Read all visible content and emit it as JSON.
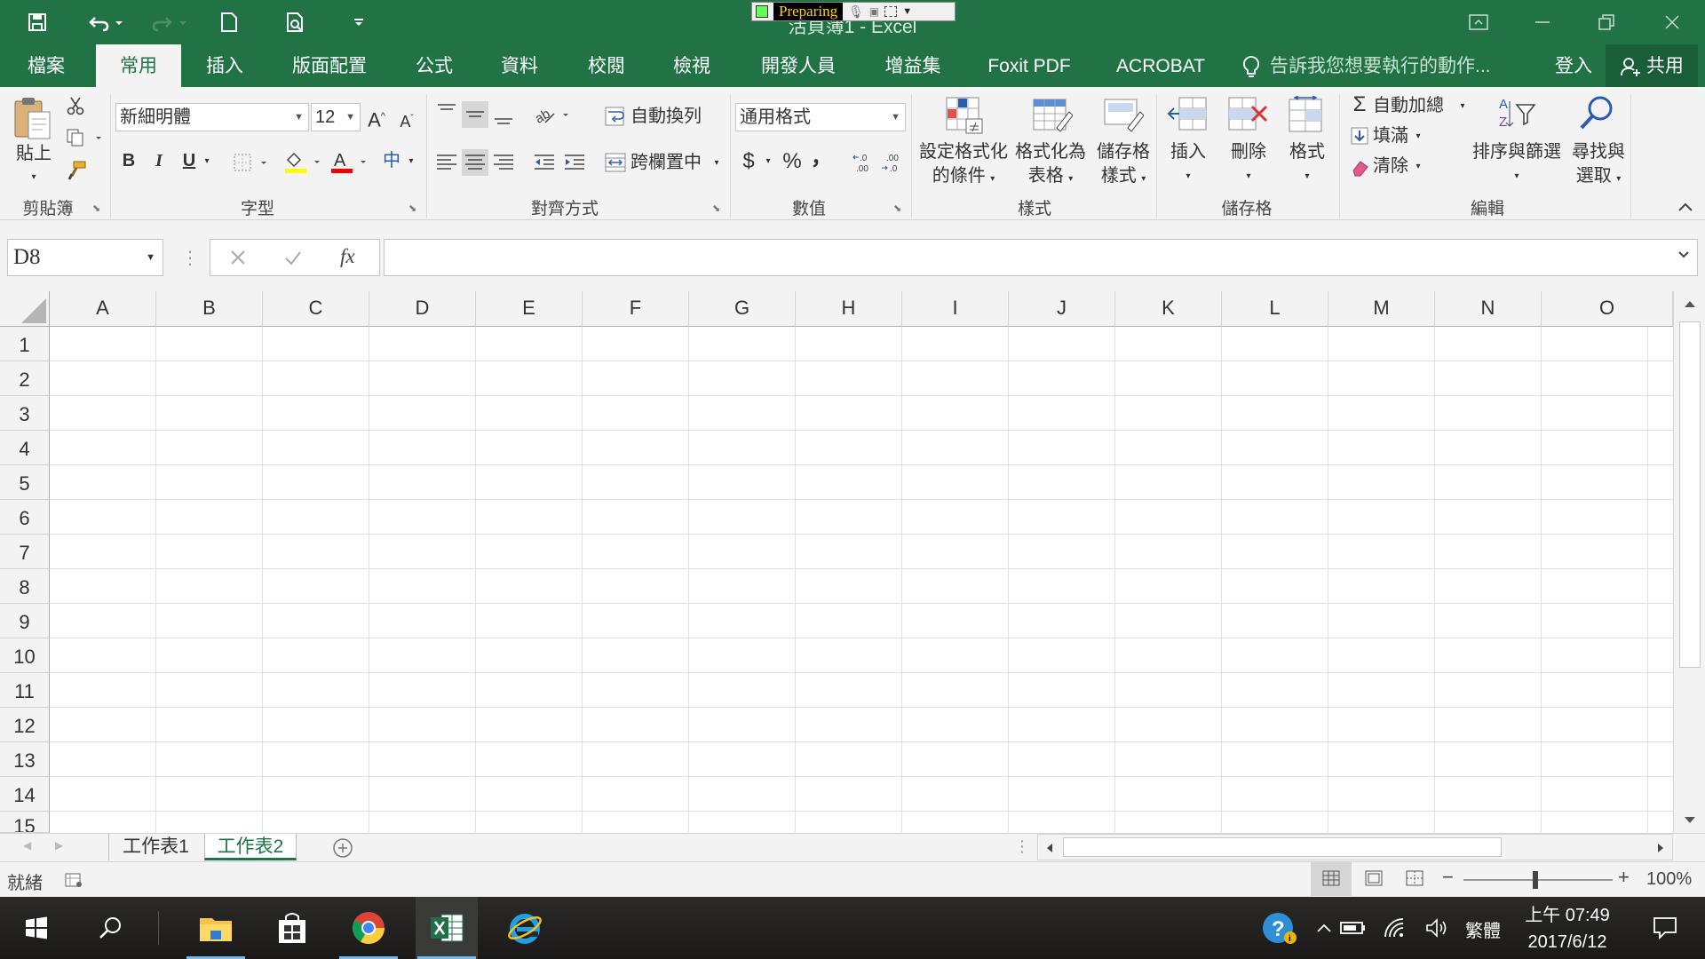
{
  "window": {
    "title": "活頁簿1 - Excel",
    "recorder_status": "Preparing"
  },
  "tabs": [
    {
      "label": "檔案"
    },
    {
      "label": "常用"
    },
    {
      "label": "插入"
    },
    {
      "label": "版面配置"
    },
    {
      "label": "公式"
    },
    {
      "label": "資料"
    },
    {
      "label": "校閱"
    },
    {
      "label": "檢視"
    },
    {
      "label": "開發人員"
    },
    {
      "label": "增益集"
    },
    {
      "label": "Foxit PDF"
    },
    {
      "label": "ACROBAT"
    }
  ],
  "tell_me": "告訴我您想要執行的動作...",
  "sign_in": "登入",
  "share": "共用",
  "ribbon": {
    "groups": {
      "clipboard": "剪貼簿",
      "font": "字型",
      "alignment": "對齊方式",
      "number": "數值",
      "styles": "樣式",
      "cells": "儲存格",
      "editing": "編輯"
    },
    "paste": "貼上",
    "font_name": "新細明體",
    "font_size": "12",
    "wrap_text": "自動換列",
    "merge_center": "跨欄置中",
    "number_format": "通用格式",
    "currency": "$",
    "percent": "%",
    "comma": "，",
    "cond_format": [
      "設定格式化",
      "的條件"
    ],
    "format_table": [
      "格式化為",
      "表格"
    ],
    "cell_styles": [
      "儲存格",
      "樣式"
    ],
    "insert": "插入",
    "delete": "刪除",
    "format": "格式",
    "autosum": "自動加總",
    "fill": "填滿",
    "clear": "清除",
    "sort_filter": "排序與篩選",
    "find_select": [
      "尋找與",
      "選取"
    ],
    "bold": "B",
    "italic": "I",
    "underline": "U",
    "phonetic": "中",
    "font_color": "A"
  },
  "formula_bar": {
    "name_box": "D8",
    "fx": "fx",
    "formula": ""
  },
  "columns": [
    "A",
    "B",
    "C",
    "D",
    "E",
    "F",
    "G",
    "H",
    "I",
    "J",
    "K",
    "L",
    "M",
    "N",
    "O"
  ],
  "rows": [
    "1",
    "2",
    "3",
    "4",
    "5",
    "6",
    "7",
    "8",
    "9",
    "10",
    "11",
    "12",
    "13",
    "14",
    "15"
  ],
  "sheets": [
    {
      "name": "工作表1",
      "active": false
    },
    {
      "name": "工作表2",
      "active": true
    }
  ],
  "status": {
    "ready": "就緒",
    "zoom": "100%"
  },
  "taskbar": {
    "ime": "繁體",
    "time": "上午 07:49",
    "date": "2017/6/12"
  },
  "colors": {
    "excel_green": "#217346",
    "ribbon_bg": "#f3f3f3",
    "taskbar_bg": "#222120"
  }
}
